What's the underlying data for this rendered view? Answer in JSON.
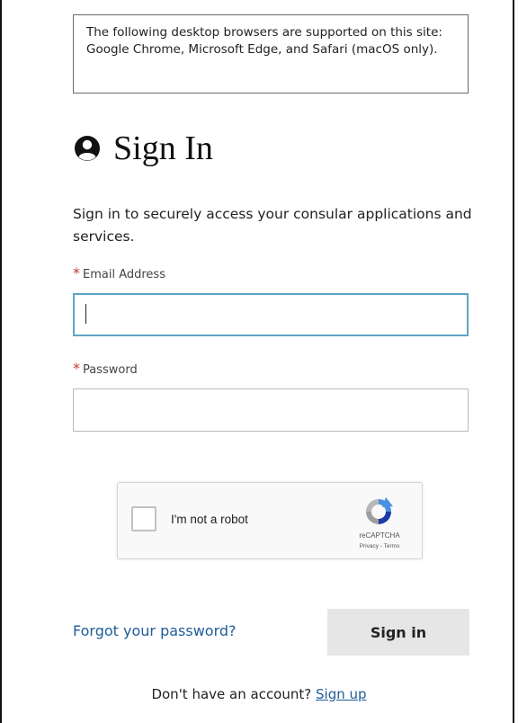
{
  "notice": {
    "text": "The following desktop browsers are supported on this site: Google Chrome, Microsoft Edge, and Safari (macOS only)."
  },
  "header": {
    "icon": "user-circle-icon",
    "title": "Sign In"
  },
  "intro": {
    "text": "Sign in to securely access your consular applications and services."
  },
  "form": {
    "required_mark": "*",
    "email": {
      "label": "Email Address",
      "value": "",
      "placeholder": ""
    },
    "password": {
      "label": "Password",
      "value": "",
      "placeholder": ""
    }
  },
  "recaptcha": {
    "label": "I'm not a robot",
    "brand": "reCAPTCHA",
    "links": "Privacy - Terms",
    "icon": "recaptcha-logo-icon"
  },
  "actions": {
    "forgot_label": "Forgot your password?",
    "signin_label": "Sign in"
  },
  "footer": {
    "prompt": "Don't have an account?",
    "signup_label": "Sign up"
  },
  "colors": {
    "link": "#1f5d99",
    "required": "#c0392b",
    "focus_border": "#5ea3c3",
    "button_bg": "#e6e6e6"
  }
}
